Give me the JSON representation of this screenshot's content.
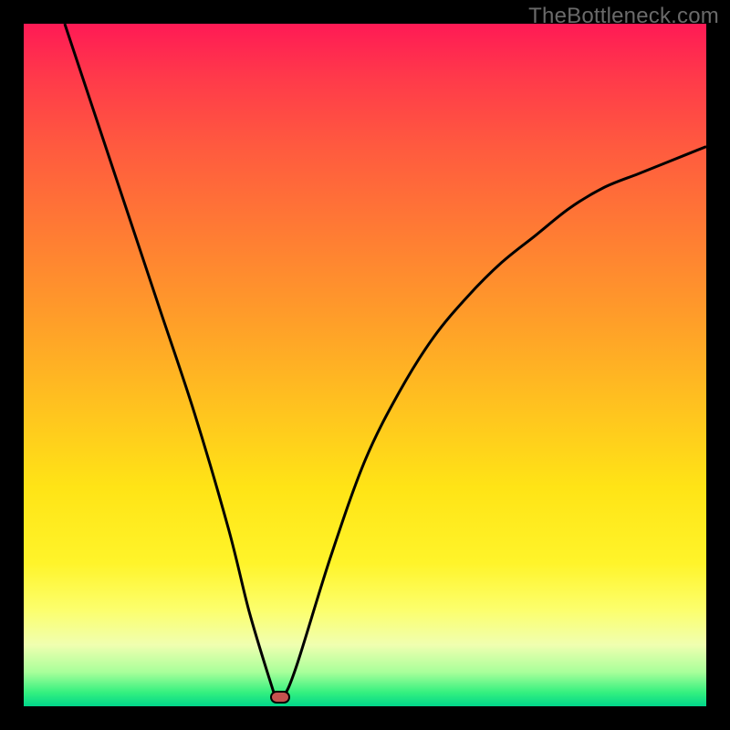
{
  "watermark": "TheBottleneck.com",
  "chart_data": {
    "type": "line",
    "title": "",
    "xlabel": "",
    "ylabel": "",
    "xlim": [
      0,
      100
    ],
    "ylim": [
      0,
      100
    ],
    "grid": false,
    "series": [
      {
        "name": "curve",
        "x": [
          6,
          10,
          15,
          20,
          25,
          30,
          33,
          36,
          37,
          38,
          40,
          45,
          50,
          55,
          60,
          65,
          70,
          75,
          80,
          85,
          90,
          95,
          100
        ],
        "y": [
          100,
          88,
          73,
          58,
          43,
          26,
          14,
          4,
          1.3,
          1.3,
          6,
          22,
          36,
          46,
          54,
          60,
          65,
          69,
          73,
          76,
          78,
          80,
          82
        ]
      }
    ],
    "marker": {
      "x": 37.5,
      "y": 1.3
    },
    "colors": {
      "curve": "#000000",
      "marker_fill": "#c6524f",
      "marker_stroke": "#000000",
      "gradient_top": "#ff1a55",
      "gradient_bottom": "#00d68a"
    }
  }
}
